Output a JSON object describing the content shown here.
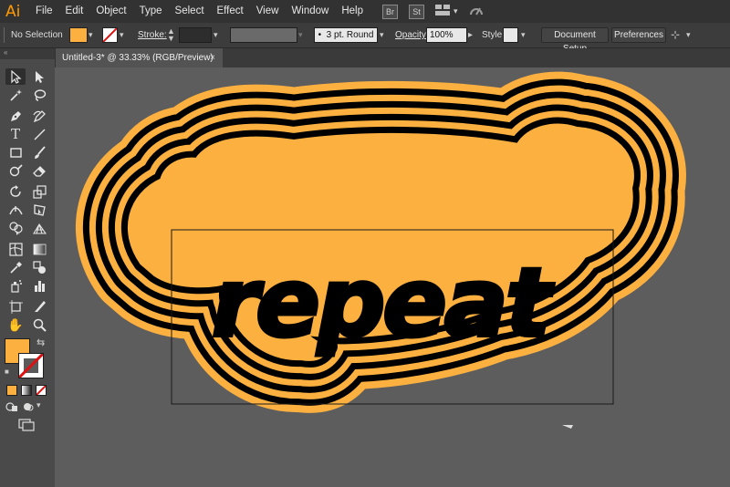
{
  "app": {
    "logo": "Ai"
  },
  "menu": [
    "File",
    "Edit",
    "Object",
    "Type",
    "Select",
    "Effect",
    "View",
    "Window",
    "Help"
  ],
  "menu_icons": {
    "bridge": "Br",
    "stock": "St"
  },
  "control": {
    "selection_status": "No Selection",
    "stroke_label": "Stroke:",
    "brush": "3 pt. Round",
    "opacity_label": "Opacity:",
    "opacity_value": "100%",
    "style_label": "Style:",
    "document_setup": "Document Setup",
    "preferences": "Preferences"
  },
  "document": {
    "tab_title": "Untitled-3* @ 33.33% (RGB/Preview)",
    "close": "×"
  },
  "artwork": {
    "text": "repeat",
    "fill_color": "#fbb040",
    "ink_color": "#000000"
  },
  "colors": {
    "fill": "#fbb040",
    "stroke": "#ffffff",
    "canvas": "#5d5d5d",
    "chrome": "#323232"
  },
  "tools": [
    "selection-tool-icon",
    "direct-selection-tool-icon",
    "magic-wand-tool-icon",
    "lasso-tool-icon",
    "pen-tool-icon",
    "curvature-tool-icon",
    "type-tool-icon",
    "line-segment-tool-icon",
    "rectangle-tool-icon",
    "paintbrush-tool-icon",
    "shaper-tool-icon",
    "eraser-tool-icon",
    "rotate-tool-icon",
    "scale-tool-icon",
    "width-tool-icon",
    "free-transform-tool-icon",
    "shape-builder-tool-icon",
    "perspective-grid-tool-icon",
    "mesh-tool-icon",
    "gradient-tool-icon",
    "eyedropper-tool-icon",
    "blend-tool-icon",
    "symbol-sprayer-tool-icon",
    "column-graph-tool-icon",
    "artboard-tool-icon",
    "slice-tool-icon",
    "hand-tool-icon",
    "zoom-tool-icon"
  ]
}
